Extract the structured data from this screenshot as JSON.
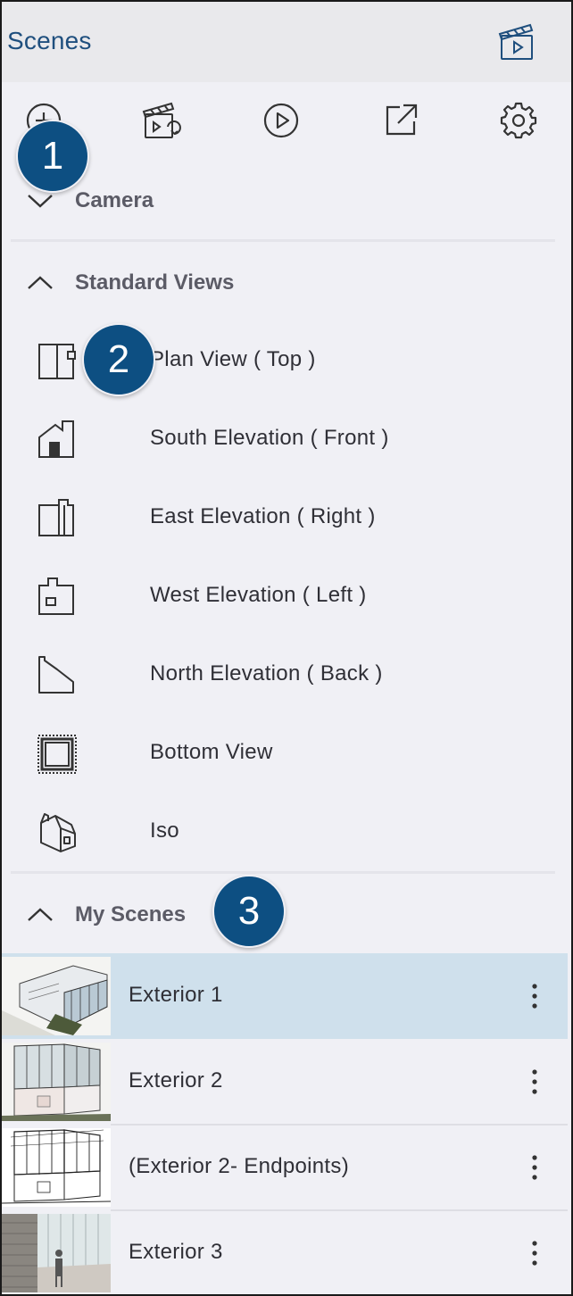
{
  "header": {
    "title": "Scenes",
    "icon": "scene-clapper-play-icon"
  },
  "toolbar": {
    "icons": [
      "add-scene-icon",
      "update-scene-icon",
      "play-animation-icon",
      "export-icon",
      "settings-icon"
    ]
  },
  "callouts": [
    "1",
    "2",
    "3"
  ],
  "sections": {
    "camera": {
      "label": "Camera",
      "state": "collapsed"
    },
    "standard_views": {
      "label": "Standard Views",
      "state": "expanded",
      "items": [
        {
          "label": "Plan View ( Top )",
          "icon": "plan-view-icon"
        },
        {
          "label": "South Elevation ( Front )",
          "icon": "front-elevation-icon"
        },
        {
          "label": "East Elevation ( Right )",
          "icon": "right-elevation-icon"
        },
        {
          "label": "West Elevation ( Left )",
          "icon": "left-elevation-icon"
        },
        {
          "label": "North Elevation ( Back )",
          "icon": "back-elevation-icon"
        },
        {
          "label": "Bottom View",
          "icon": "bottom-view-icon"
        },
        {
          "label": "Iso",
          "icon": "iso-view-icon"
        }
      ]
    },
    "my_scenes": {
      "label": "My Scenes",
      "state": "expanded",
      "items": [
        {
          "label": "Exterior 1",
          "selected": true
        },
        {
          "label": "Exterior 2",
          "selected": false
        },
        {
          "label": "(Exterior 2- Endpoints)",
          "selected": false
        },
        {
          "label": "Exterior 3",
          "selected": false
        }
      ]
    }
  },
  "colors": {
    "accent": "#1f4f7e",
    "badge": "#0d4f82",
    "selected_row": "#cfe0ec",
    "panel_bg": "#f0f0f5",
    "header_bg": "#e9e9ec"
  }
}
